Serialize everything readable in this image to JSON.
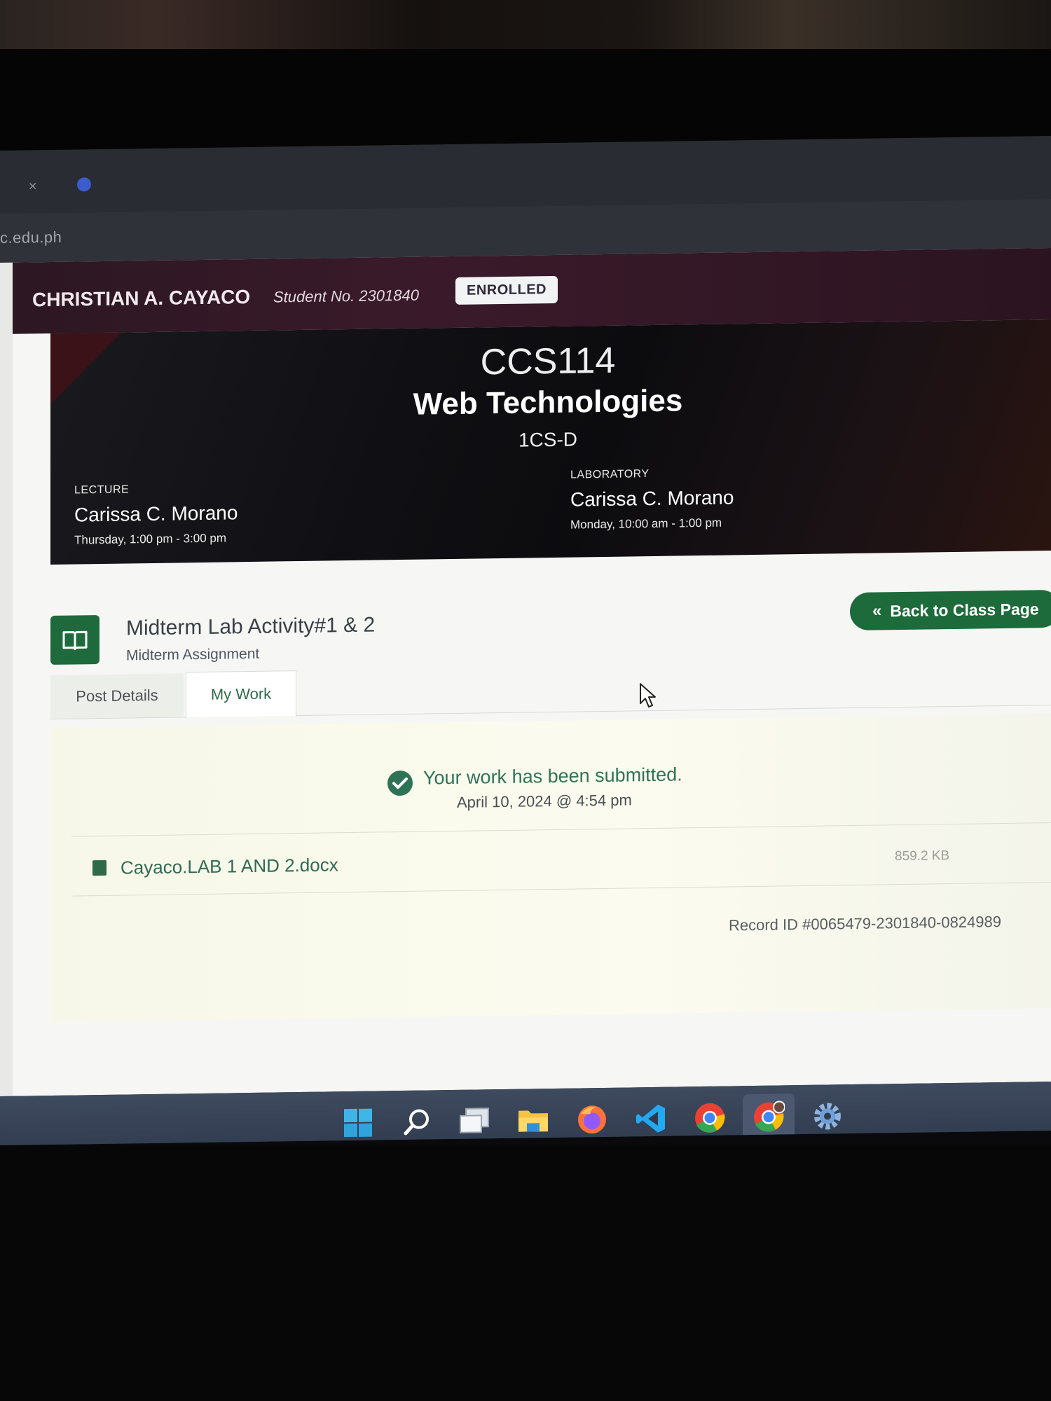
{
  "browser": {
    "url_fragment": "c.edu.ph"
  },
  "header": {
    "student_name": "CHRISTIAN A. CAYACO",
    "student_no": "Student No. 2301840",
    "status_badge": "ENROLLED"
  },
  "course": {
    "code": "CCS114",
    "title": "Web Technologies",
    "section": "1CS-D",
    "lecture": {
      "label": "LECTURE",
      "instructor": "Carissa C. Morano",
      "schedule": "Thursday, 1:00 pm - 3:00 pm"
    },
    "laboratory": {
      "label": "LABORATORY",
      "instructor": "Carissa C. Morano",
      "schedule": "Monday, 10:00 am - 1:00 pm"
    }
  },
  "assignment": {
    "title": "Midterm Lab Activity#1 & 2",
    "subtitle": "Midterm Assignment",
    "back_label": "Back to Class Page",
    "icon": "book-icon"
  },
  "tabs": [
    {
      "label": "Post Details",
      "active": false
    },
    {
      "label": "My Work",
      "active": true
    }
  ],
  "submission": {
    "status_text": "Your work has been submitted.",
    "date": "April 10, 2024 @ 4:54 pm",
    "file_name": "Cayaco.LAB 1 AND 2.docx",
    "file_size": "859.2 KB",
    "record_id": "Record ID #0065479-2301840-0824989"
  },
  "taskbar": {
    "items": [
      "windows-start-icon",
      "search-icon",
      "task-view-icon",
      "file-explorer-icon",
      "firefox-icon",
      "vscode-icon",
      "chrome-icon",
      "chrome-profile-icon",
      "settings-icon"
    ]
  },
  "colors": {
    "accent_green": "#1d6a3b",
    "header_maroon": "#3a1a2a",
    "success_green": "#2f7357"
  }
}
